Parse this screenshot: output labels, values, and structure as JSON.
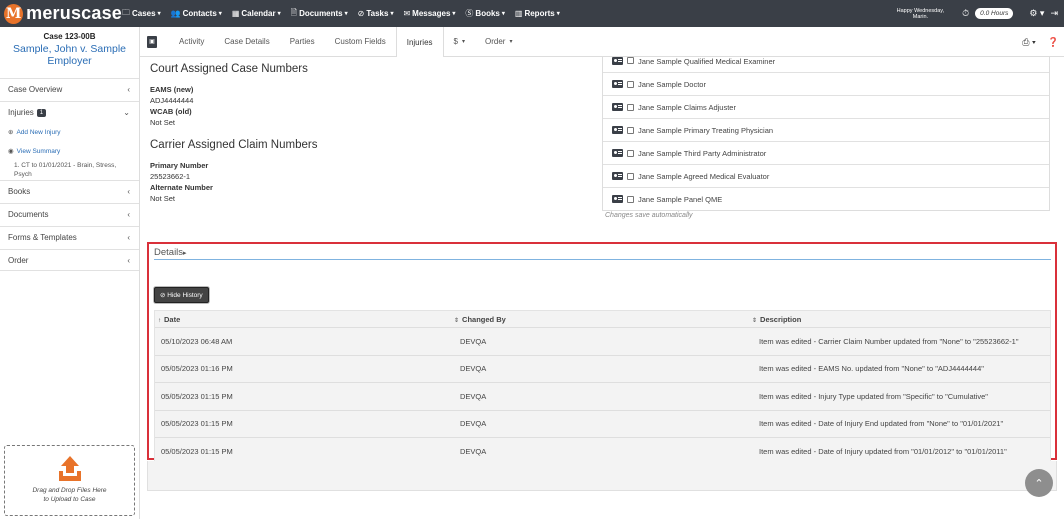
{
  "app": {
    "logo_letter": "M",
    "logo_text_a": "merus",
    "logo_text_b": "case"
  },
  "nav": {
    "items": [
      {
        "label": "Cases",
        "icon": "folder-icon",
        "glyph": "🗀"
      },
      {
        "label": "Contacts",
        "icon": "contacts-icon",
        "glyph": "👥"
      },
      {
        "label": "Calendar",
        "icon": "calendar-icon",
        "glyph": "▦"
      },
      {
        "label": "Documents",
        "icon": "document-icon",
        "glyph": "🗎"
      },
      {
        "label": "Tasks",
        "icon": "tasks-icon",
        "glyph": "⊘"
      },
      {
        "label": "Messages",
        "icon": "envelope-icon",
        "glyph": "✉"
      },
      {
        "label": "Books",
        "icon": "books-icon",
        "glyph": "Ⓢ"
      },
      {
        "label": "Reports",
        "icon": "chart-icon",
        "glyph": "▥"
      }
    ],
    "greeting_line1": "Happy Wednesday,",
    "greeting_line2": "Marin.",
    "hours": "0.0 Hours"
  },
  "sidebar": {
    "case_number": "Case 123-00B",
    "case_name": "Sample, John v. Sample Employer",
    "case_overview": "Case Overview",
    "injuries": "Injuries",
    "injuries_count": "1",
    "add_injury": "Add New Injury",
    "view_summary": "View Summary",
    "injury_item": "1. CT to 01/01/2021 - Brain, Stress, Psych",
    "books": "Books",
    "documents": "Documents",
    "forms": "Forms & Templates",
    "order": "Order",
    "dropzone_line1": "Drag and Drop Files Here",
    "dropzone_line2": "to Upload to Case"
  },
  "tabs": {
    "activity": "Activity",
    "case_details": "Case Details",
    "parties": "Parties",
    "custom_fields": "Custom Fields",
    "injuries": "Injuries",
    "dollar": "$",
    "order": "Order"
  },
  "court": {
    "title": "Court Assigned Case Numbers",
    "eams_label": "EAMS (new)",
    "eams_value": "ADJ4444444",
    "wcab_label": "WCAB (old)",
    "wcab_value": "Not Set"
  },
  "carrier": {
    "title": "Carrier Assigned Claim Numbers",
    "primary_label": "Primary Number",
    "primary_value": "25523662-1",
    "alternate_label": "Alternate Number",
    "alternate_value": "Not Set"
  },
  "parties": [
    "Jane Sample Qualified Medical Examiner",
    "Jane Sample Doctor",
    "Jane Sample Claims Adjuster",
    "Jane Sample Primary Treating Physician",
    "Jane Sample Third Party Administrator",
    "Jane Sample Agreed Medical Evaluator",
    "Jane Sample Panel QME"
  ],
  "autosave": "Changes save automatically",
  "details": {
    "title": "Details",
    "hide_history": "Hide History",
    "columns": {
      "date": "Date",
      "changed_by": "Changed By",
      "description": "Description"
    },
    "rows": [
      {
        "date": "05/10/2023 06:48 AM",
        "by": "DEVQA",
        "desc": "Item was edited - Carrier Claim Number updated from \"None\" to \"25523662-1\""
      },
      {
        "date": "05/05/2023 01:16 PM",
        "by": "DEVQA",
        "desc": "Item was edited - EAMS No. updated from \"None\" to \"ADJ4444444\""
      },
      {
        "date": "05/05/2023 01:15 PM",
        "by": "DEVQA",
        "desc": "Item was edited - Injury Type updated from \"Specific\" to \"Cumulative\""
      },
      {
        "date": "05/05/2023 01:15 PM",
        "by": "DEVQA",
        "desc": "Item was edited - Date of Injury End updated from \"None\" to \"01/01/2021\""
      },
      {
        "date": "05/05/2023 01:15 PM",
        "by": "DEVQA",
        "desc": "Item was edited - Date of Injury updated from \"01/01/2012\" to \"01/01/2011\""
      }
    ]
  },
  "colors": {
    "nav_bg": "#3a3f47",
    "accent": "#e8732a",
    "link": "#2a6db5",
    "highlight": "#d9303a"
  }
}
